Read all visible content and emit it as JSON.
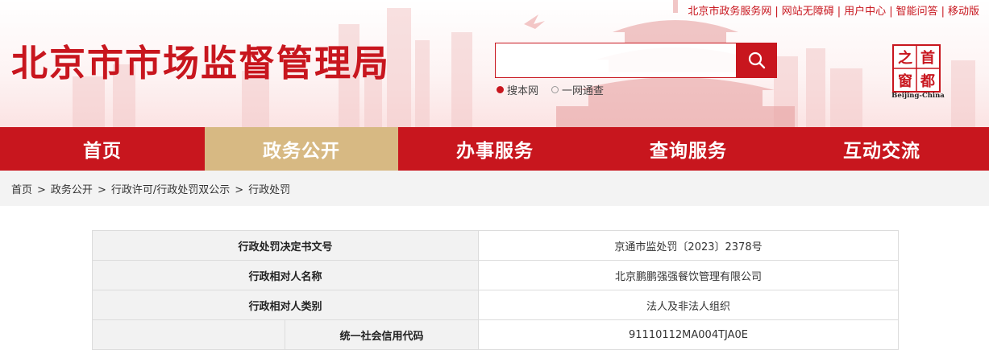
{
  "header": {
    "site_title": "北京市市场监督管理局",
    "top_links": [
      "北京市政务服务网",
      "网站无障碍",
      "用户中心",
      "智能问答",
      "移动版"
    ],
    "search": {
      "placeholder": "",
      "options": [
        {
          "label": "搜本网",
          "selected": true
        },
        {
          "label": "一网通查",
          "selected": false
        }
      ]
    },
    "logo": {
      "chars": [
        "首",
        "都",
        "之",
        "窗"
      ],
      "caption": "Beijing-China"
    }
  },
  "nav": {
    "items": [
      {
        "label": "首页",
        "active": false
      },
      {
        "label": "政务公开",
        "active": true
      },
      {
        "label": "办事服务",
        "active": false
      },
      {
        "label": "查询服务",
        "active": false
      },
      {
        "label": "互动交流",
        "active": false
      }
    ]
  },
  "breadcrumb": [
    "首页",
    "政务公开",
    "行政许可/行政处罚双公示",
    "行政处罚"
  ],
  "detail_table": {
    "rows": [
      {
        "label": "行政处罚决定书文号",
        "value": "京通市监处罚〔2023〕2378号"
      },
      {
        "label": "行政相对人名称",
        "value": "北京鹏鹏强强餐饮管理有限公司"
      },
      {
        "label": "行政相对人类别",
        "value": "法人及非法人组织"
      },
      {
        "label": "统一社会信用代码",
        "value": "91110112MA004TJA0E"
      }
    ]
  },
  "colors": {
    "brand_red": "#c8161e",
    "nav_active": "#d7b983"
  }
}
